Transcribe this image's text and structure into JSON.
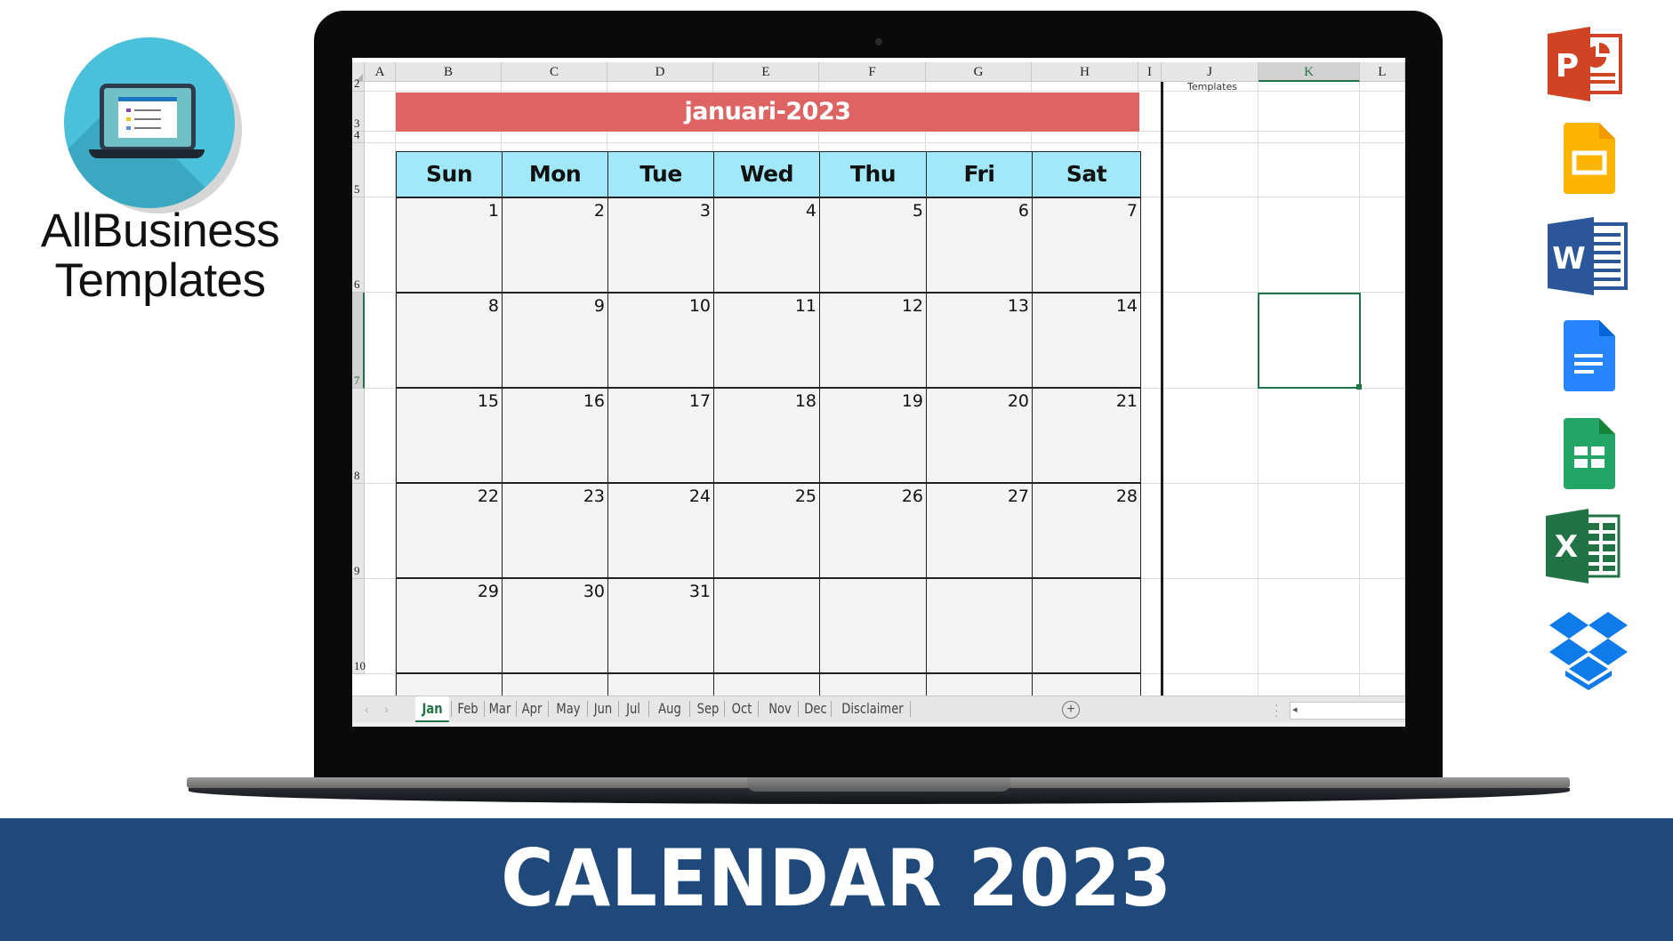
{
  "brand": {
    "logo_icon": "laptop-list-icon",
    "name_line1": "AllBusiness",
    "name_line2": "Templates"
  },
  "spreadsheet": {
    "columns": [
      "A",
      "B",
      "C",
      "D",
      "E",
      "F",
      "G",
      "H",
      "I",
      "J",
      "K",
      "L"
    ],
    "selected_column": "K",
    "rows": [
      "2",
      "3",
      "4",
      "5",
      "6",
      "7",
      "8",
      "9",
      "10"
    ],
    "selected_row": "7",
    "month_title": "januari-2023",
    "weekdays": [
      "Sun",
      "Mon",
      "Tue",
      "Wed",
      "Thu",
      "Fri",
      "Sat"
    ],
    "weeks": [
      [
        "1",
        "2",
        "3",
        "4",
        "5",
        "6",
        "7"
      ],
      [
        "8",
        "9",
        "10",
        "11",
        "12",
        "13",
        "14"
      ],
      [
        "15",
        "16",
        "17",
        "18",
        "19",
        "20",
        "21"
      ],
      [
        "22",
        "23",
        "24",
        "25",
        "26",
        "27",
        "28"
      ],
      [
        "29",
        "30",
        "31",
        "",
        "",
        "",
        ""
      ]
    ],
    "side_caption": "Templates",
    "selected_cell": "K7",
    "colors": {
      "title_fill": "#de6464",
      "weekday_fill": "#a2e8fb",
      "day_fill": "#f4f4f4",
      "selection": "#217346"
    }
  },
  "sheet_tabs": {
    "active": "Jan",
    "tabs": [
      "Jan",
      "Feb",
      "Mar",
      "Apr",
      "May",
      "Jun",
      "Jul",
      "Aug",
      "Sep",
      "Oct",
      "Nov",
      "Dec",
      "Disclaimer"
    ],
    "add_label": "+",
    "nav_prev": "‹",
    "nav_next": "›",
    "scroll_left": "◂"
  },
  "app_icons": [
    "powerpoint-icon",
    "google-slides-icon",
    "word-icon",
    "google-docs-icon",
    "google-sheets-icon",
    "excel-icon",
    "dropbox-icon"
  ],
  "app_icon_letters": {
    "powerpoint": "P",
    "word": "W",
    "excel": "X"
  },
  "banner": {
    "title": "CALENDAR 2023",
    "color": "#20497b"
  }
}
